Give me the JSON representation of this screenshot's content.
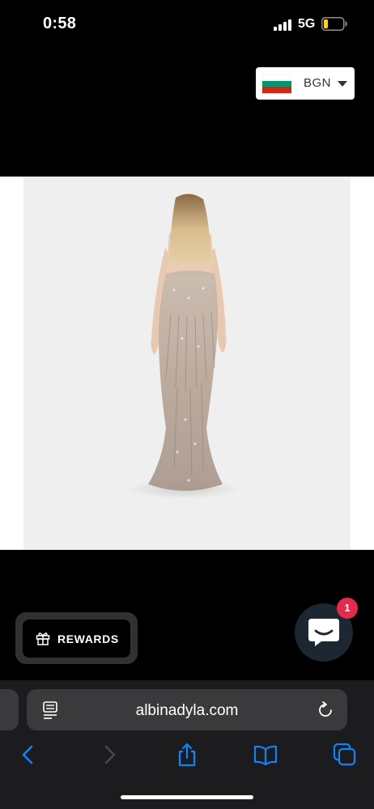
{
  "status_bar": {
    "time": "0:58",
    "network": "5G"
  },
  "currency_selector": {
    "code": "BGN",
    "flag_icon": "bulgaria-flag-icon"
  },
  "product": {
    "image_icon": "product-photo-evening-gown"
  },
  "rewards": {
    "label": "REWARDS",
    "icon": "gift-icon"
  },
  "chat": {
    "badge_count": "1",
    "icon": "chat-bubble-icon"
  },
  "browser": {
    "url": "albinadyla.com",
    "icons": [
      "reader-icon",
      "reload-icon",
      "back-icon",
      "forward-icon",
      "share-icon",
      "bookmarks-icon",
      "tabs-icon"
    ]
  },
  "colors": {
    "accent": "#0a84ff",
    "badge": "#e8294c",
    "chat_bg": "#1d2731"
  }
}
